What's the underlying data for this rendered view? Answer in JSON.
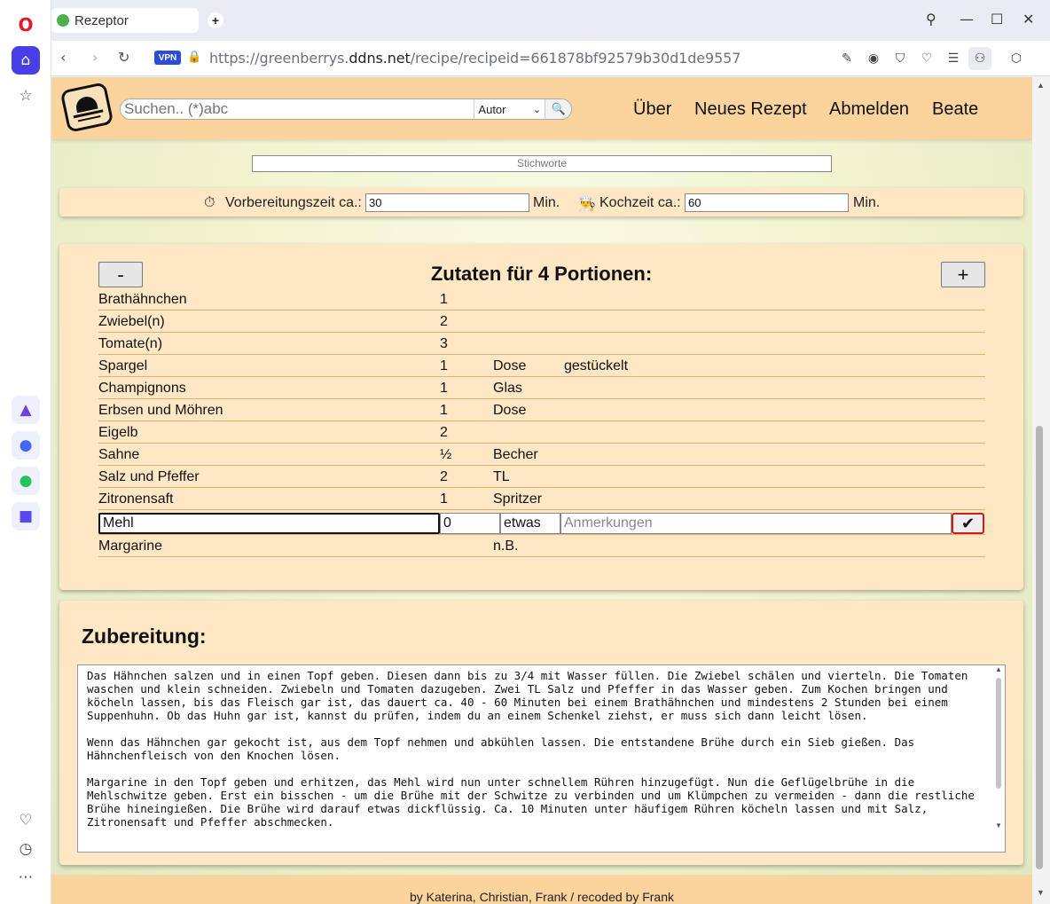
{
  "browser": {
    "tab_title": "Rezeptor",
    "url_prefix": "https://greenberrys.",
    "url_domain": "ddns.net",
    "url_path": "/recipe/recipeid=661878bf92579b30d1de9557",
    "vpn_label": "VPN"
  },
  "header": {
    "search_placeholder": "Suchen.. (*)abc",
    "search_filter": "Autor",
    "menu": {
      "about": "Über",
      "new_recipe": "Neues Rezept",
      "logout": "Abmelden",
      "user": "Beate"
    }
  },
  "tags_placeholder": "Stichworte",
  "times": {
    "prep_label": "Vorbereitungszeit ca.:",
    "prep_value": "30",
    "cook_label": "Kochzeit ca.:",
    "cook_value": "60",
    "unit": "Min."
  },
  "ingredients": {
    "minus_label": "-",
    "plus_label": "+",
    "title": "Zutaten für 4 Portionen:",
    "rows": [
      {
        "name": "Brathähnchen",
        "qty": "1",
        "unit": "",
        "note": ""
      },
      {
        "name": "Zwiebel(n)",
        "qty": "2",
        "unit": "",
        "note": ""
      },
      {
        "name": "Tomate(n)",
        "qty": "3",
        "unit": "",
        "note": ""
      },
      {
        "name": "Spargel",
        "qty": "1",
        "unit": "Dose",
        "note": "gestückelt"
      },
      {
        "name": "Champignons",
        "qty": "1",
        "unit": "Glas",
        "note": ""
      },
      {
        "name": "Erbsen und Möhren",
        "qty": "1",
        "unit": "Dose",
        "note": ""
      },
      {
        "name": "Eigelb",
        "qty": "2",
        "unit": "",
        "note": ""
      },
      {
        "name": "Sahne",
        "qty": "½",
        "unit": "Becher",
        "note": ""
      },
      {
        "name": "Salz und Pfeffer",
        "qty": "2",
        "unit": "TL",
        "note": ""
      },
      {
        "name": "Zitronensaft",
        "qty": "1",
        "unit": "Spritzer",
        "note": ""
      }
    ],
    "edit_row": {
      "name": "Mehl",
      "qty": "0",
      "unit": "etwas",
      "note_placeholder": "Anmerkungen",
      "confirm": "✔"
    },
    "last_row": {
      "name": "Margarine",
      "qty": "",
      "unit": "n.B.",
      "note": ""
    }
  },
  "preparation": {
    "title": "Zubereitung:",
    "text": "Das Hähnchen salzen und in einen Topf geben. Diesen dann bis zu 3/4 mit Wasser füllen. Die Zwiebel schälen und vierteln. Die Tomaten waschen und klein schneiden. Zwiebeln und Tomaten dazugeben. Zwei TL Salz und Pfeffer in das Wasser geben. Zum Kochen bringen und köcheln lassen, bis das Fleisch gar ist, das dauert ca. 40 - 60 Minuten bei einem Brathähnchen und mindestens 2 Stunden bei einem Suppenhuhn. Ob das Huhn gar ist, kannst du prüfen, indem du an einem Schenkel ziehst, er muss sich dann leicht lösen.\n\nWenn das Hähnchen gar gekocht ist, aus dem Topf nehmen und abkühlen lassen. Die entstandene Brühe durch ein Sieb gießen. Das Hähnchenfleisch von den Knochen lösen.\n\nMargarine in den Topf geben und erhitzen, das Mehl wird nun unter schnellem Rühren hinzugefügt. Nun die Geflügelbrühe in die Mehlschwitze geben. Erst ein bisschen - um die Brühe mit der Schwitze zu verbinden und um Klümpchen zu vermeiden - dann die restliche Brühe hineingießen. Die Brühe wird darauf etwas dickflüssig. Ca. 10 Minuten unter häufigem Rühren köcheln lassen und mit Salz, Zitronensaft und Pfeffer abschmecken."
  },
  "footer": {
    "text": "by Katerina, Christian, Frank    /    recoded by Frank"
  }
}
